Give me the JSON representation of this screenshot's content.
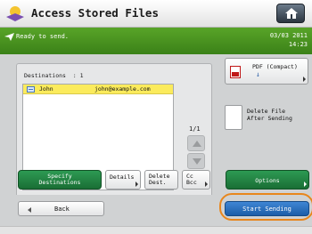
{
  "titlebar": {
    "title": "Access Stored Files"
  },
  "status": {
    "message": "Ready to send.",
    "date": "03/03 2011",
    "time": "14:23"
  },
  "destinations": {
    "header": "Destinations  : 1",
    "rows": [
      {
        "name": "John",
        "email": "john@example.com"
      }
    ],
    "page_counter": "1/1"
  },
  "buttons": {
    "specify_line1": "Specify",
    "specify_line2": "Destinations",
    "details": "Details",
    "delete_line1": "Delete",
    "delete_line2": "Dest.",
    "cc_line1": "Cc",
    "cc_line2": "Bcc",
    "pdf": "PDF (Compact)",
    "pdf_sub": "↓",
    "delete_after_line1": "Delete File",
    "delete_after_line2": "After Sending",
    "options": "Options",
    "back": "Back",
    "start": "Start Sending"
  },
  "colors": {
    "status_green": "#4a9620",
    "button_green": "#1f7a3c",
    "start_blue": "#2a6fc0",
    "highlight": "#e8861c",
    "selected_row": "#fbeb5c"
  }
}
